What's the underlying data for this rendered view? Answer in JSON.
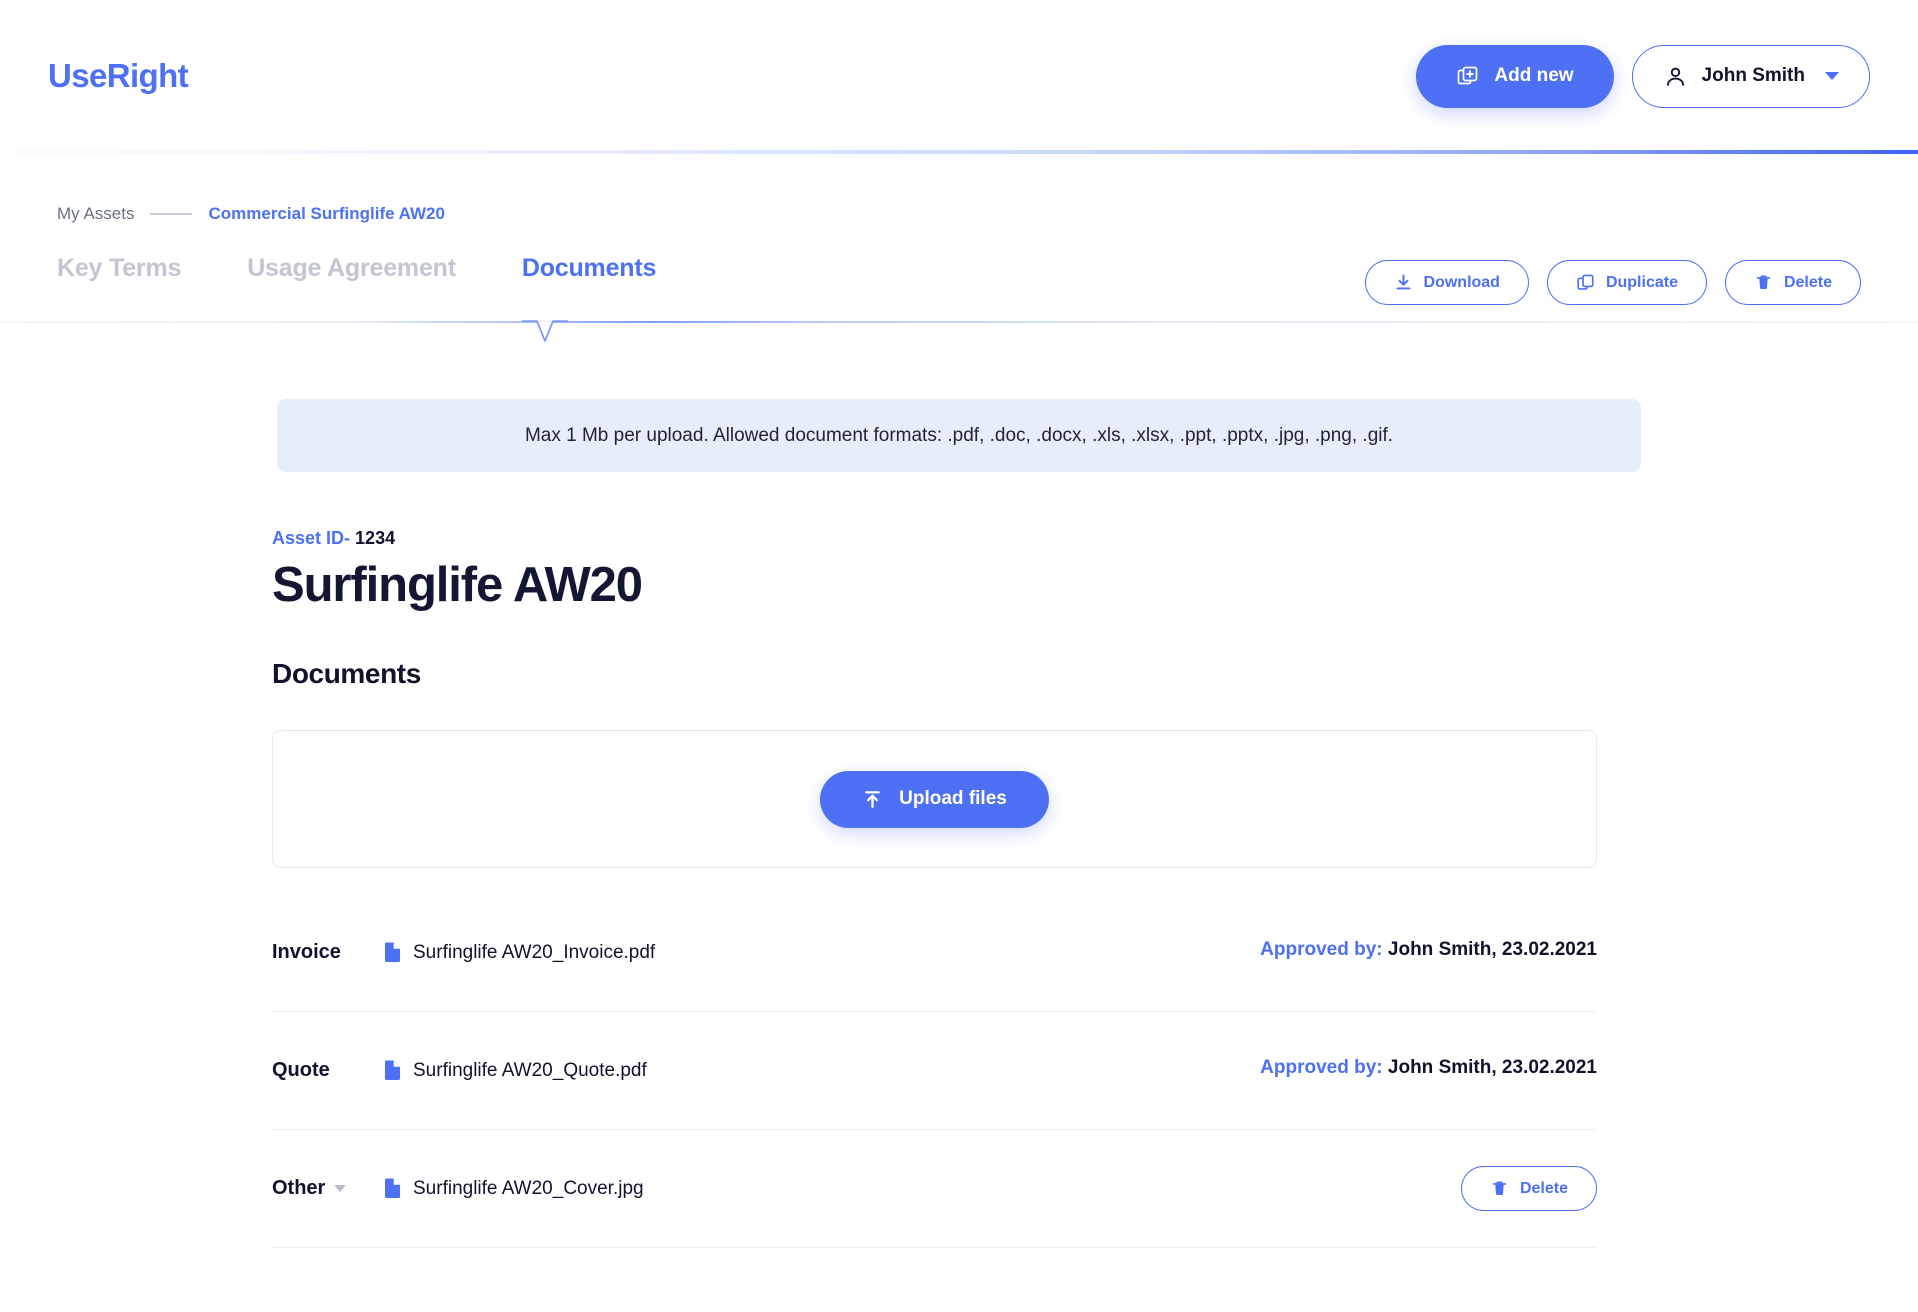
{
  "header": {
    "logo": "UseRight",
    "add_new_label": "Add new",
    "add_new_icon": "add-document-icon",
    "user_name": "John Smith",
    "user_icon": "person-icon",
    "user_caret_icon": "chevron-down-icon"
  },
  "breadcrumb": {
    "root": "My Assets",
    "current": "Commercial Surfinglife AW20"
  },
  "tabs": [
    {
      "label": "Key Terms",
      "active": false
    },
    {
      "label": "Usage Agreement",
      "active": false
    },
    {
      "label": "Documents",
      "active": true
    }
  ],
  "actions": [
    {
      "label": "Download",
      "icon": "download-icon"
    },
    {
      "label": "Duplicate",
      "icon": "copy-icon"
    },
    {
      "label": "Delete",
      "icon": "trash-icon"
    }
  ],
  "banner": {
    "text": "Max 1 Mb per upload. Allowed document formats: .pdf, .doc, .docx, .xls, .xlsx, .ppt, .pptx, .jpg, .png, .gif."
  },
  "asset": {
    "id_label": "Asset ID-",
    "id_value": "1234",
    "title": "Surfinglife AW20"
  },
  "documents_section": {
    "title": "Documents",
    "upload_button_label": "Upload files",
    "upload_button_icon": "upload-icon"
  },
  "documents": [
    {
      "type": "Invoice",
      "has_type_dropdown": false,
      "file_icon": "file-icon",
      "file_name": "Surfinglife AW20_Invoice.pdf",
      "approved_label": "Approved by:",
      "approved_value": "John Smith, 23.02.2021",
      "delete_label": null,
      "delete_icon": null
    },
    {
      "type": "Quote",
      "has_type_dropdown": false,
      "file_icon": "file-icon",
      "file_name": "Surfinglife AW20_Quote.pdf",
      "approved_label": "Approved by:",
      "approved_value": "John Smith, 23.02.2021",
      "delete_label": null,
      "delete_icon": null
    },
    {
      "type": "Other",
      "has_type_dropdown": true,
      "file_icon": "file-icon",
      "file_name": "Surfinglife AW20_Cover.jpg",
      "approved_label": null,
      "approved_value": null,
      "delete_label": "Delete",
      "delete_icon": "trash-icon"
    }
  ],
  "colors": {
    "primary": "#4D70F5",
    "text_dark": "#10132B",
    "text_muted": "#c3c6d0",
    "banner_bg": "#e7eefa",
    "border_light": "#eceff4"
  }
}
